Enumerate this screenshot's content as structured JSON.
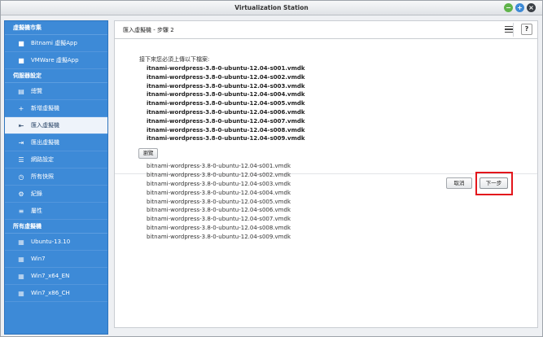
{
  "window": {
    "title": "Virtualization Station",
    "buttons": [
      "−",
      "+",
      "×"
    ]
  },
  "sidebar": {
    "sections": [
      {
        "title": "虛擬機市集",
        "items": [
          {
            "label": "Bitnami 虛擬App",
            "icon": "bitnami-icon",
            "glyph": "■"
          },
          {
            "label": "VMWare 虛擬App",
            "icon": "vmware-icon",
            "glyph": "■"
          }
        ]
      },
      {
        "title": "伺服器設定",
        "items": [
          {
            "label": "總覽",
            "icon": "overview-icon",
            "glyph": "▤"
          },
          {
            "label": "新增虛擬機",
            "icon": "plus-icon",
            "glyph": "+"
          },
          {
            "label": "匯入虛擬機",
            "icon": "import-icon",
            "glyph": "⇤",
            "active": true
          },
          {
            "label": "匯出虛擬機",
            "icon": "export-icon",
            "glyph": "⇥"
          },
          {
            "label": "網路設定",
            "icon": "network-icon",
            "glyph": "☰"
          },
          {
            "label": "所有快照",
            "icon": "snapshot-icon",
            "glyph": "◷"
          },
          {
            "label": "紀錄",
            "icon": "log-icon",
            "glyph": "⚙"
          },
          {
            "label": "屬性",
            "icon": "properties-icon",
            "glyph": "≡"
          }
        ]
      },
      {
        "title": "所有虛擬機",
        "items": [
          {
            "label": "Ubuntu-13.10",
            "icon": "vm-icon",
            "glyph": "▦"
          },
          {
            "label": "Win7",
            "icon": "vm-icon",
            "glyph": "▦"
          },
          {
            "label": "Win7_x64_EN",
            "icon": "vm-icon",
            "glyph": "▦"
          },
          {
            "label": "Win7_x86_CH",
            "icon": "vm-icon",
            "glyph": "▦"
          }
        ]
      }
    ]
  },
  "main": {
    "title": "匯入虛擬機 - 步驟 2",
    "instruction": "接下來您必須上傳以下檔案:",
    "required_files": [
      "itnami-wordpress-3.8-0-ubuntu-12.04-s001.vmdk",
      "itnami-wordpress-3.8-0-ubuntu-12.04-s002.vmdk",
      "itnami-wordpress-3.8-0-ubuntu-12.04-s003.vmdk",
      "itnami-wordpress-3.8-0-ubuntu-12.04-s004.vmdk",
      "itnami-wordpress-3.8-0-ubuntu-12.04-s005.vmdk",
      "itnami-wordpress-3.8-0-ubuntu-12.04-s006.vmdk",
      "itnami-wordpress-3.8-0-ubuntu-12.04-s007.vmdk",
      "itnami-wordpress-3.8-0-ubuntu-12.04-s008.vmdk",
      "itnami-wordpress-3.8-0-ubuntu-12.04-s009.vmdk"
    ],
    "browse_label": "瀏覽",
    "selected_files": [
      "bitnami-wordpress-3.8-0-ubuntu-12.04-s001.vmdk",
      "bitnami-wordpress-3.8-0-ubuntu-12.04-s002.vmdk",
      "bitnami-wordpress-3.8-0-ubuntu-12.04-s003.vmdk",
      "bitnami-wordpress-3.8-0-ubuntu-12.04-s004.vmdk",
      "bitnami-wordpress-3.8-0-ubuntu-12.04-s005.vmdk",
      "bitnami-wordpress-3.8-0-ubuntu-12.04-s006.vmdk",
      "bitnami-wordpress-3.8-0-ubuntu-12.04-s007.vmdk",
      "bitnami-wordpress-3.8-0-ubuntu-12.04-s008.vmdk",
      "bitnami-wordpress-3.8-0-ubuntu-12.04-s009.vmdk"
    ],
    "cancel_label": "取消",
    "next_label": "下一步",
    "help_label": "?"
  },
  "colors": {
    "sidebar_bg": "#3d8ad7",
    "highlight": "#e3161c"
  }
}
